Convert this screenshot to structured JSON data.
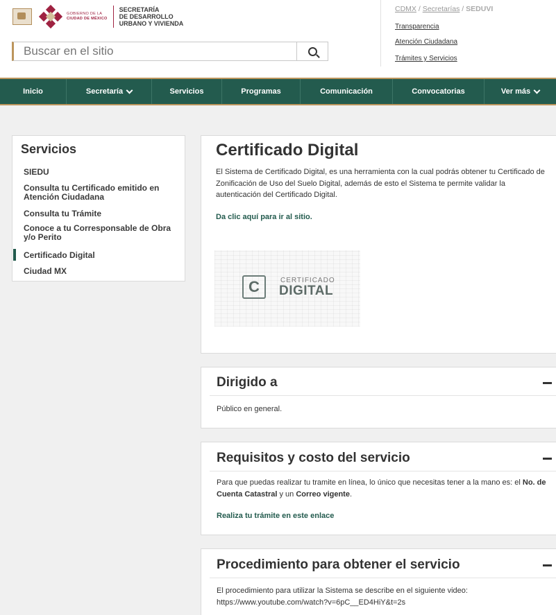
{
  "header": {
    "logo": {
      "gobierno_line1": "GOBIERNO DE LA",
      "gobierno_line2": "CIUDAD DE MÉXICO",
      "secretaria_line1": "SECRETARÍA",
      "secretaria_line2": "DE DESARROLLO",
      "secretaria_line3": "URBANO Y VIVIENDA",
      "brand_color": "#9f2241"
    },
    "search": {
      "placeholder": "Buscar en el sitio",
      "icon": "search-icon"
    },
    "breadcrumb": {
      "cdmx": "CDMX",
      "sep1": " / ",
      "secretarias": "Secretarías",
      "sep2": " / ",
      "current": "SEDUVI"
    },
    "top_links": [
      "Transparencia",
      "Atención Ciudadana",
      "Trámites y Servicios"
    ]
  },
  "nav": {
    "color": "#235b4e",
    "accent": "#bc955c",
    "items": [
      {
        "label": "Inicio",
        "dropdown": false
      },
      {
        "label": "Secretaría",
        "dropdown": true
      },
      {
        "label": "Servicios",
        "dropdown": false
      },
      {
        "label": "Programas",
        "dropdown": false
      },
      {
        "label": "Comunicación",
        "dropdown": false
      },
      {
        "label": "Convocatorias",
        "dropdown": false
      },
      {
        "label": "Ver más",
        "dropdown": true
      }
    ]
  },
  "sidebar": {
    "title": "Servicios",
    "items": [
      "SIEDU",
      "Consulta tu Certificado emitido en Atención Ciudadana",
      "Consulta tu Trámite",
      "Conoce a tu Corresponsable de Obra y/o Perito",
      "Certificado Digital",
      "Ciudad MX"
    ],
    "active": "Certificado Digital"
  },
  "main": {
    "title": "Certificado Digital",
    "intro": "El Sistema de Certificado Digital, es una herramienta con la cual podrás obtener tu Certificado de Zonificación de Uso del Suelo Digital, además de esto el Sistema te permite validar la autenticación del Certificado Digital.",
    "link": "Da clic aquí para ir al sitio.",
    "image": {
      "letter": "C",
      "line1": "CERTIFICADO",
      "line2": "DIGITAL"
    }
  },
  "sections": {
    "dirigido": {
      "title": "Dirigido a",
      "text": "Público en general."
    },
    "requisitos": {
      "title": "Requisitos y costo del servicio",
      "text_a": "Para que puedas realizar tu tramite en línea, lo único que necesitas tener a la mano es: el ",
      "bold1": "No. de Cuenta Catastral",
      "text_b": " y un ",
      "bold2": "Correo vigente",
      "text_c": ".",
      "link": "Realiza tu trámite en este enlace"
    },
    "procedimiento": {
      "title": "Procedimiento para obtener el servicio",
      "text": "El procedimiento para utilizar la Sistema se describe en el siguiente video:",
      "url": "https://www.youtube.com/watch?v=6pC__ED4HiY&t=2s"
    }
  }
}
